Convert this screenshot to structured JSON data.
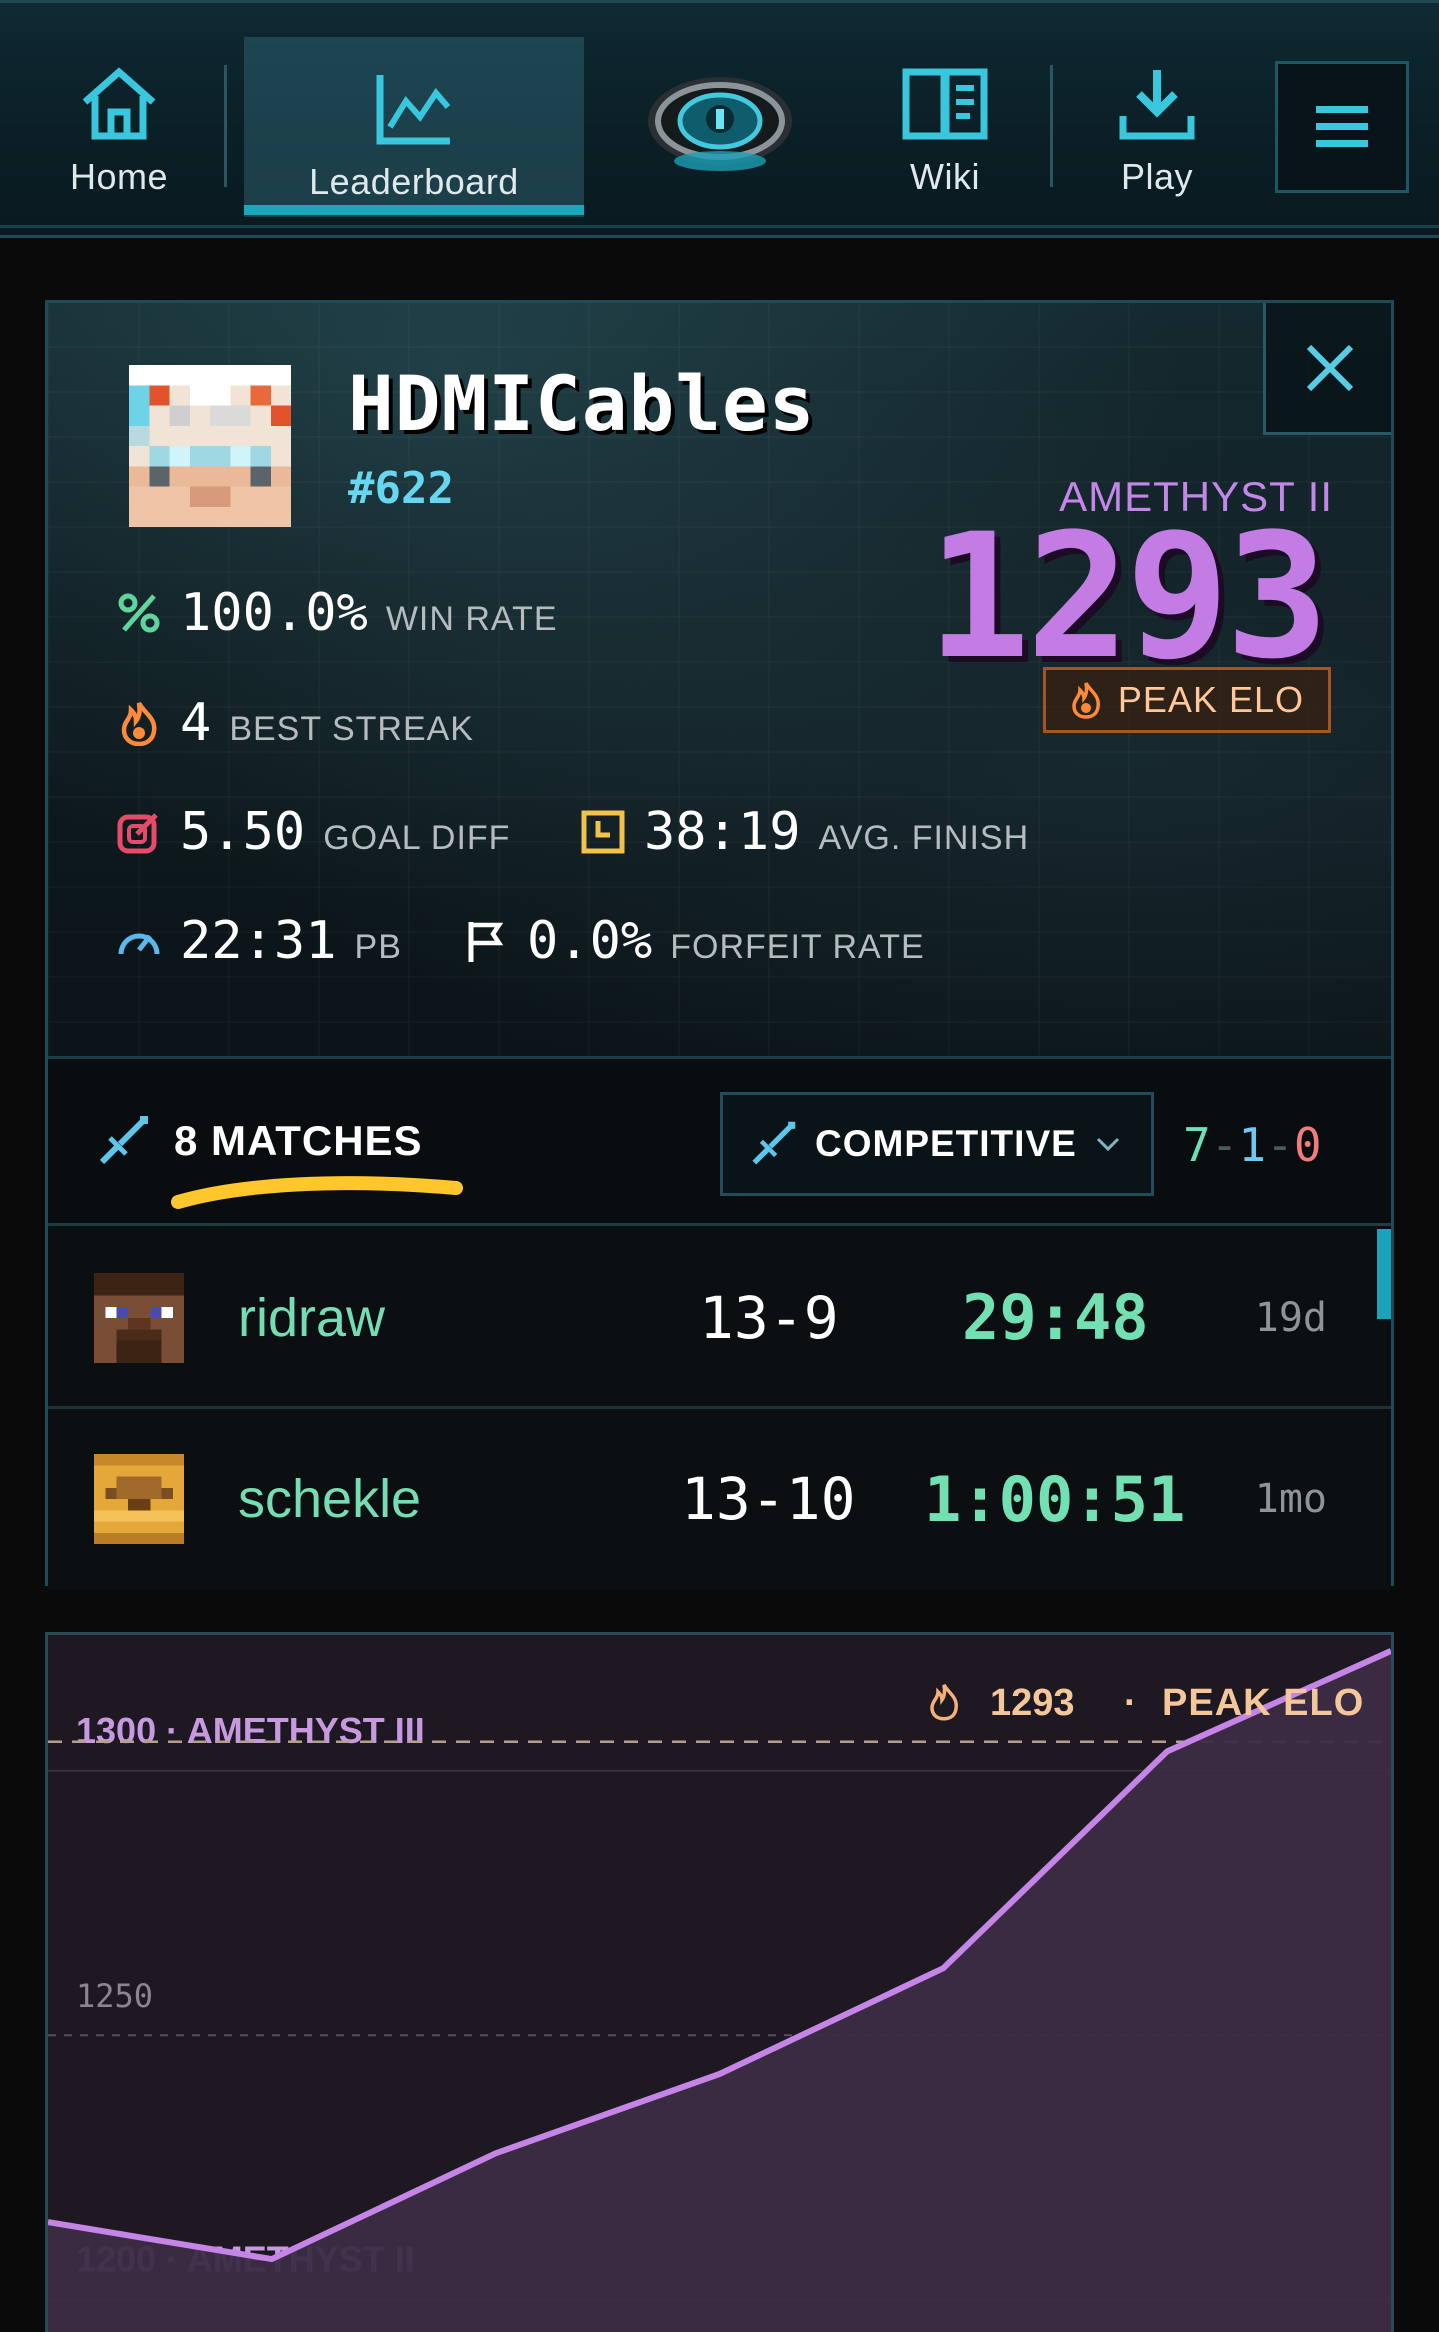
{
  "nav": {
    "items": [
      {
        "label": "Home",
        "icon": "home-icon"
      },
      {
        "label": "Leaderboard",
        "icon": "chart-line-icon",
        "active": true
      },
      {
        "label": "Wiki",
        "icon": "book-icon"
      },
      {
        "label": "Play",
        "icon": "download-icon"
      }
    ],
    "logo": "eye-logo",
    "menu_icon": "hamburger-icon"
  },
  "profile": {
    "name": "HDMICables",
    "rank": "#622",
    "tier": "AMETHYST II",
    "elo": "1293",
    "peak_badge": "PEAK ELO",
    "stats": {
      "win_rate": {
        "value": "100.0%",
        "label": "WIN RATE",
        "icon": "percent-icon"
      },
      "best_streak": {
        "value": "4",
        "label": "BEST STREAK",
        "icon": "fire-icon"
      },
      "goal_diff": {
        "value": "5.50",
        "label": "GOAL DIFF",
        "icon": "target-icon"
      },
      "avg_finish": {
        "value": "38:19",
        "label": "AVG. FINISH",
        "icon": "clock-icon"
      },
      "pb": {
        "value": "22:31",
        "label": "PB",
        "icon": "speedometer-icon"
      },
      "forfeit_rate": {
        "value": "0.0%",
        "label": "FORFEIT RATE",
        "icon": "flag-icon"
      }
    }
  },
  "matches": {
    "count_label": "8 MATCHES",
    "mode": "COMPETITIVE",
    "record": {
      "wins": "7",
      "losses": "1",
      "draws": "0",
      "sep": "-"
    },
    "rows": [
      {
        "opponent": "ridraw",
        "score": "13-9",
        "time": "29:48",
        "ago": "19d"
      },
      {
        "opponent": "schekle",
        "score": "13-10",
        "time": "1:00:51",
        "ago": "1mo"
      }
    ]
  },
  "colors": {
    "accent": "#1aa6bb",
    "amethyst": "#c27ce4",
    "win": "#72e0b3",
    "peak": "#ffc79a"
  },
  "chart_data": {
    "type": "area",
    "ylim": [
      1185,
      1320
    ],
    "y_labels": [
      {
        "y": 1300,
        "text": "1300 · AMETHYST III"
      },
      {
        "y": 1250,
        "text": "1250"
      },
      {
        "y": 1200,
        "text": "1200 · AMETHYST II"
      }
    ],
    "peak": {
      "value": "1293",
      "label": "PEAK ELO",
      "sep": "·"
    },
    "x": [
      0,
      1,
      2,
      3,
      4,
      5,
      6
    ],
    "values": [
      1209,
      1202,
      1222,
      1237,
      1257,
      1298,
      1317
    ]
  }
}
